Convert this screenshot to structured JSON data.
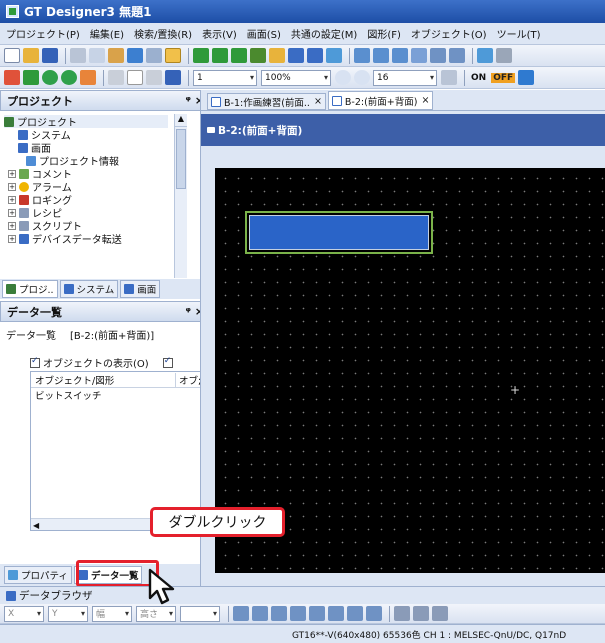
{
  "window": {
    "title": "GT Designer3 無題1"
  },
  "menu": [
    "プロジェクト(P)",
    "編集(E)",
    "検索/置換(R)",
    "表示(V)",
    "画面(S)",
    "共通の設定(M)",
    "図形(F)",
    "オブジェクト(O)",
    "ツール(T)"
  ],
  "toolbar": {
    "zoom": "100%",
    "grid": "16",
    "line_value": "1",
    "on_label": "ON",
    "off_label": "OFF"
  },
  "project_pane": {
    "title": "プロジェクト",
    "pin": "ᵠ ×",
    "items": [
      "プロジェクト",
      "システム",
      "画面",
      "プロジェクト情報",
      "コメント",
      "アラーム",
      "ロギング",
      "レシピ",
      "スクリプト",
      "デバイスデータ転送"
    ],
    "tabs": [
      "プロジ..",
      "システム",
      "画面"
    ]
  },
  "data_pane": {
    "title": "データ一覧",
    "pin": "ᵠ ×",
    "label": "データ一覧",
    "screen": "[B-2:(前面+背面)]",
    "show_objects": "オブジェクトの表示(O)",
    "col_object": "オブジェクト/図形",
    "col_sub": "オブ;",
    "rows": [
      "ビットスイッチ"
    ]
  },
  "bottom_tabs": [
    "プロパティ",
    "データ一覧"
  ],
  "browser_tab": "データブラウザ",
  "doc_tabs": [
    "B-1:作画練習(前面..",
    "B-2:(前面+背面)"
  ],
  "screen_title": "B-2:(前面+背面)",
  "callout": {
    "text": "ダブルクリック"
  },
  "status": {
    "text": "GT16**-V(640x480)  65536色  CH 1 : MELSEC-QnU/DC, Q17nD"
  },
  "colors": {
    "callout_border": "#e4202c",
    "switch_fill": "#2a64c8",
    "switch_border": "#7bb34a"
  }
}
